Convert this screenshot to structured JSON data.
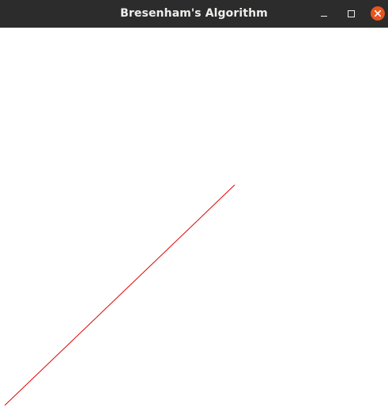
{
  "window": {
    "title": "Bresenham's Algorithm",
    "controls": {
      "minimize_icon": "minimize-icon",
      "maximize_icon": "maximize-icon",
      "close_icon": "close-icon"
    },
    "colors": {
      "titlebar": "#2c2c2c",
      "title_text": "#eeeeec",
      "close_button": "#e9541f",
      "canvas_background": "#ffffff"
    }
  },
  "canvas": {
    "line": {
      "algorithm": "Bresenham",
      "color": "#e00000"
    }
  }
}
